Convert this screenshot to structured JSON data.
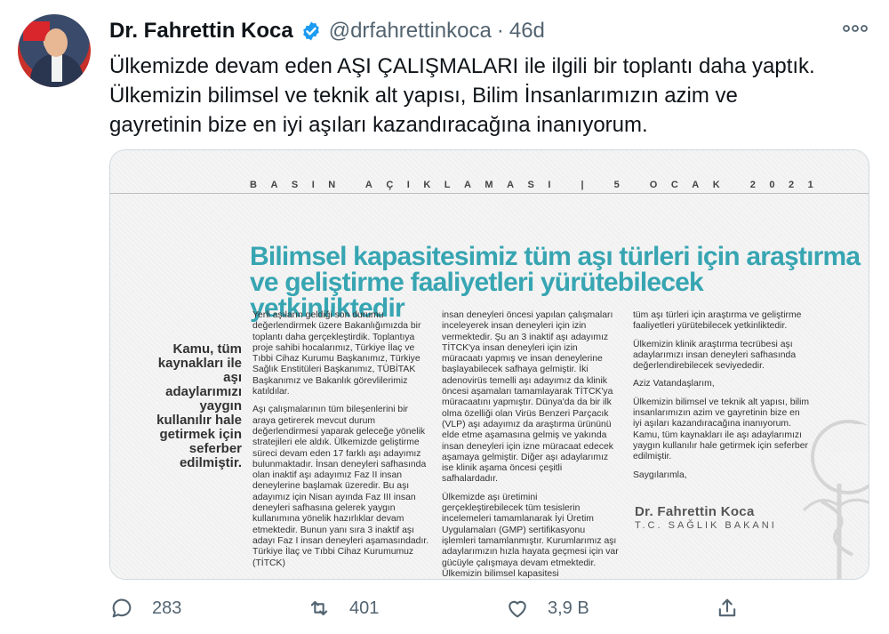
{
  "author": {
    "name": "Dr. Fahrettin Koca",
    "handle": "@drfahrettinkoca",
    "separator": "·",
    "time": "46d"
  },
  "tweet": {
    "text_line1": "Ülkemizde devam eden AŞI ÇALIŞMALARI ile ilgili bir toplantı daha yaptık.",
    "text_line2": "Ülkemizin bilimsel ve teknik alt yapısı, Bilim İnsanlarımızın azim ve",
    "text_line3": "gayretinin bize en iyi aşıları kazandıracağına inanıyorum."
  },
  "card": {
    "press_line": "BASIN AÇIKLAMASI | 5 OCAK 2021",
    "headline_1": "Bilimsel kapasitesimiz tüm aşı türleri için araştırma",
    "headline_2": "ve geliştirme faaliyetleri yürütebilecek yetkinliktedir",
    "quote": "Kamu, tüm kaynakları ile aşı adaylarımızı yaygın kullanılır hale getirmek için seferber edilmiştir.",
    "col1_p1": "Yerli aşıların geldiği son durumu değerlendirmek üzere Bakanlığımızda bir toplantı daha gerçekleştirdik. Toplantıya proje sahibi hocalarımız, Türkiye İlaç ve Tıbbi Cihaz Kurumu Başkanımız, Türkiye Sağlık Enstitüleri Başkanımız, TÜBİTAK Başkanımız ve Bakanlık görevlilerimiz katıldılar.",
    "col1_p2": "Aşı çalışmalarının tüm bileşenlerini bir araya getirerek mevcut durum değerlendirmesi yaparak geleceğe yönelik stratejileri ele aldık. Ülkemizde geliştirme süreci devam eden 17 farklı aşı adayımız bulunmaktadır. İnsan deneyleri safhasında olan inaktif aşı adayımız Faz II insan deneylerine başlamak üzeredir. Bu aşı adayımız için Nisan ayında Faz III insan deneyleri safhasına gelerek yaygın kullanımına yönelik hazırlıklar devam etmektedir. Bunun yanı sıra 3 inaktif aşı adayı Faz I insan deneyleri aşamasındadır. Türkiye İlaç ve Tıbbi Cihaz Kurumumuz (TİTCK)",
    "col2_p1": "insan deneyleri öncesi yapılan çalışmaları inceleyerek insan deneyleri için izin vermektedir. Şu an 3 inaktif aşı adayımız TİTCK'ya insan deneyleri için izin müracaatı yapmış ve insan deneylerine başlayabilecek safhaya gelmiştir. İki adenovirüs temelli aşı adayımız da klinik öncesi aşamaları tamamlayarak TİTCK'ya müracaatını yapmıştır. Dünya'da da bir ilk olma özelliği olan Virüs Benzeri Parçacık (VLP) aşı adayımız da araştırma ürününü elde etme aşamasına gelmiş ve yakında insan deneyleri için izne müracaat edecek aşamaya gelmiştir. Diğer aşı adaylarımız ise klinik aşama öncesi çeşitli safhalardadır.",
    "col2_p2": "Ülkemizde aşı üretimini gerçekleştirebilecek tüm tesislerin incelemeleri tamamlanarak İyi Üretim Uygulamaları (GMP) sertifikasyonu işlemleri tamamlanmıştır. Kurumlarımız aşı adaylarımızın hızla hayata geçmesi için var gücüyle çalışmaya devam etmektedir. Ülkemizin bilimsel kapasitesi",
    "col3_p1": "tüm aşı türleri için araştırma ve geliştirme faaliyetleri yürütebilecek yetkinliktedir.",
    "col3_p2": "Ülkemizin klinik araştırma tecrübesi aşı adaylarımızı insan deneyleri safhasında değerlendirebilecek seviyededir.",
    "col3_p3": "Aziz Vatandaşlarım,",
    "col3_p4": "Ülkemizin bilimsel ve teknik alt yapısı, bilim insanlarımızın azim ve gayretinin bize en iyi aşıları kazandıracağına inanıyorum. Kamu, tüm kaynakları ile aşı adaylarımızı yaygın kullanılır hale getirmek için seferber edilmiştir.",
    "col3_p5": "Saygılarımla,",
    "signature_name": "Dr. Fahrettin Koca",
    "signature_title": "T.C. SAĞLIK BAKANI"
  },
  "actions": {
    "reply_count": "283",
    "retweet_count": "401",
    "like_count": "3,9 B"
  },
  "colors": {
    "verified": "#1d9bf0",
    "headline": "#37a5b2",
    "muted": "#536471"
  }
}
